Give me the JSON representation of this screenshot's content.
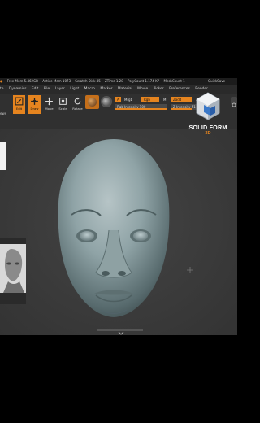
{
  "statusbar": {
    "items": [
      "Free Mem 5.462GB",
      "Active Mem 1073",
      "Scratch Disk 45",
      "ZTime 1.28",
      "PolyCount 1.174 KP",
      "MeshCount 1"
    ],
    "quicksave": "QuickSave"
  },
  "menubar": {
    "items": [
      "te",
      "Dynamics",
      "Edit",
      "File",
      "Layer",
      "Light",
      "Macro",
      "Marker",
      "Material",
      "Movie",
      "Picker",
      "Preferences",
      "Render"
    ]
  },
  "toolbar": {
    "left_label": "ews",
    "tools": [
      {
        "label": "Edit",
        "icon": "edit-icon",
        "active": true
      },
      {
        "label": "Draw",
        "icon": "draw-icon",
        "active": true
      },
      {
        "label": "Move",
        "icon": "move-icon",
        "active": false
      },
      {
        "label": "Scale",
        "icon": "scale-icon",
        "active": false
      },
      {
        "label": "Rotate",
        "icon": "rotate-icon",
        "active": false
      }
    ],
    "mrgb_label": "Mrgb",
    "rgb_label": "Rgb",
    "m_label": "M",
    "rgb_intensity": "Rgb Intensity 100",
    "zadd_label": "Zadd",
    "zsub_label": "Zsub",
    "z_intensity": "Z Intensity 51"
  },
  "logo": {
    "title": "SOLID FORM",
    "subtitle": "3D"
  },
  "colors": {
    "accent": "#e5841f",
    "background": "#3a3a3a",
    "menubar": "#2a2a2a"
  }
}
